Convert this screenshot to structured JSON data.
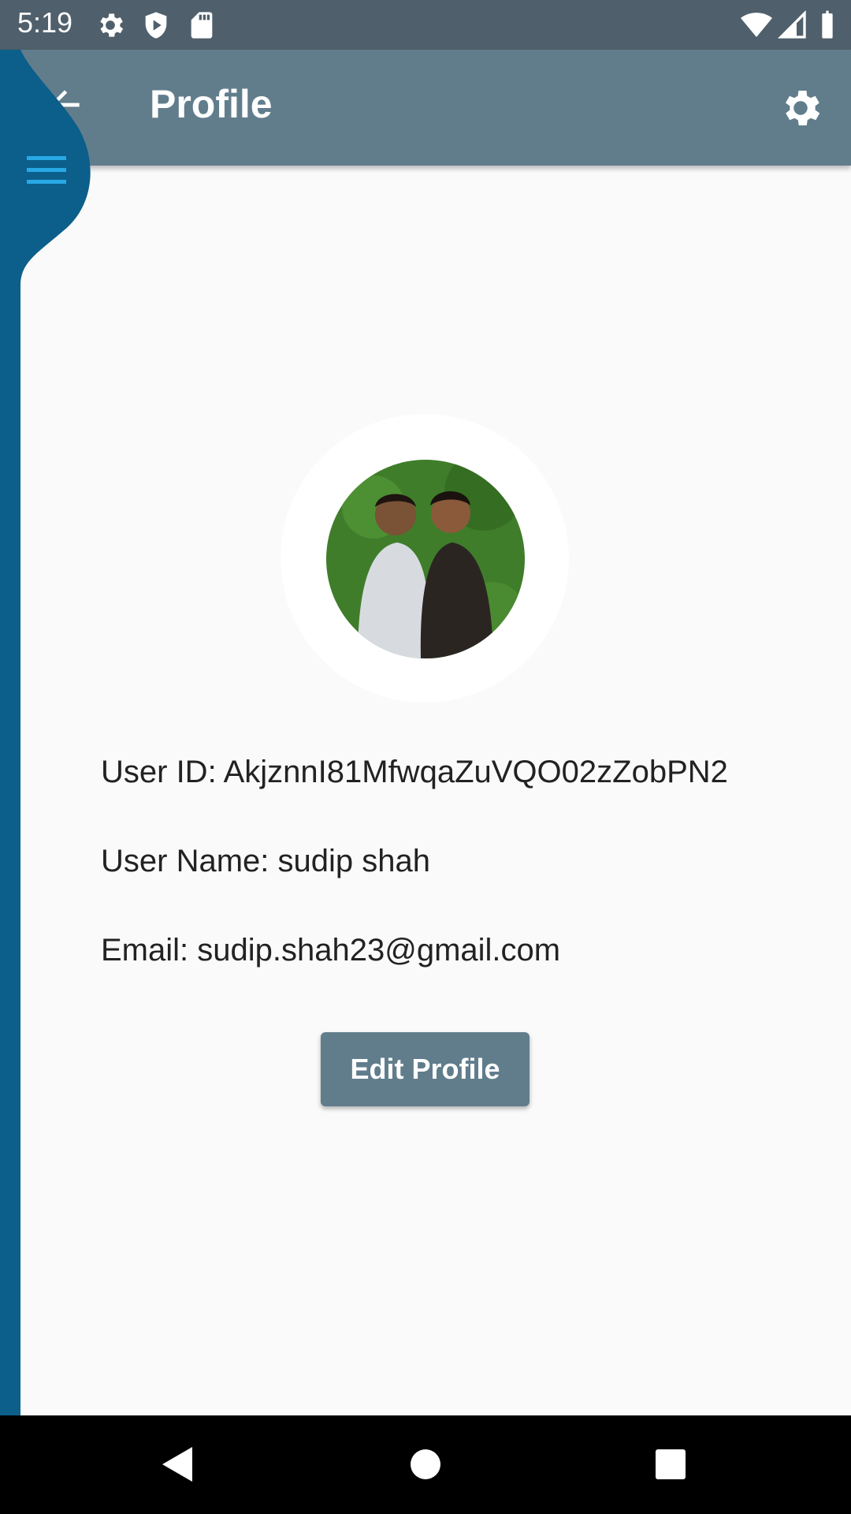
{
  "status_bar": {
    "time": "5:19",
    "icons": [
      "settings-icon",
      "shield-icon",
      "sd-card-icon",
      "wifi-icon",
      "signal-icon",
      "battery-icon"
    ]
  },
  "app_bar": {
    "title": "Profile",
    "back_icon": "arrow-back-icon",
    "action_icon": "settings-gear-icon",
    "color": "#617d8c"
  },
  "drawer": {
    "menu_icon": "hamburger-menu-icon",
    "color": "#0b5f8a",
    "icon_color": "#29a8e6"
  },
  "profile": {
    "user_id_line": "User ID: AkjznnI81MfwqaZuVQO02zZobPN2",
    "user_name_line": "User Name: sudip shah",
    "email_line": "Email: sudip.shah23@gmail.com"
  },
  "actions": {
    "edit_profile_label": "Edit Profile"
  },
  "nav_bar": {
    "icons": [
      "back-triangle-icon",
      "home-circle-icon",
      "recents-square-icon"
    ]
  }
}
